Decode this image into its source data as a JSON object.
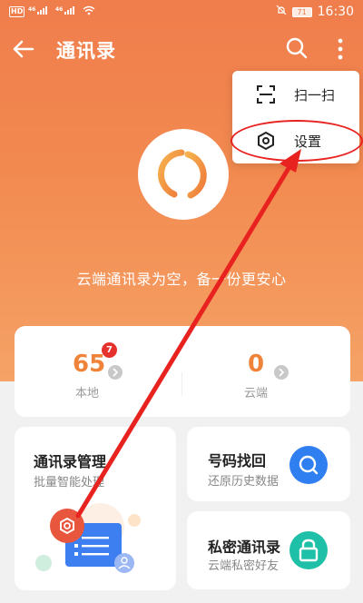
{
  "status_bar": {
    "left_icons": [
      "HD",
      "46",
      "46"
    ],
    "battery": "71",
    "time": "16:30"
  },
  "header": {
    "title": "通讯录"
  },
  "menu": {
    "items": [
      {
        "label": "扫一扫",
        "icon": "scan-icon"
      },
      {
        "label": "设置",
        "icon": "settings-hexagon-icon"
      }
    ]
  },
  "cloud": {
    "empty_text": "云端通讯录为空，备一份更安心"
  },
  "stats": {
    "local": {
      "value": "65",
      "label": "本地",
      "badge": "7"
    },
    "cloud": {
      "value": "0",
      "label": "云端"
    }
  },
  "cards": {
    "manage": {
      "title": "通讯录管理",
      "subtitle": "批量智能处理"
    },
    "recover": {
      "title": "号码找回",
      "subtitle": "还原历史数据"
    },
    "private": {
      "title": "私密通讯录",
      "subtitle": "云端私密好友"
    }
  },
  "colors": {
    "brand_orange": "#f07d4c",
    "accent_orange": "#f0833a",
    "blue": "#2f7ff0",
    "teal": "#1fc0a8",
    "annotation_red": "#e8221f"
  }
}
